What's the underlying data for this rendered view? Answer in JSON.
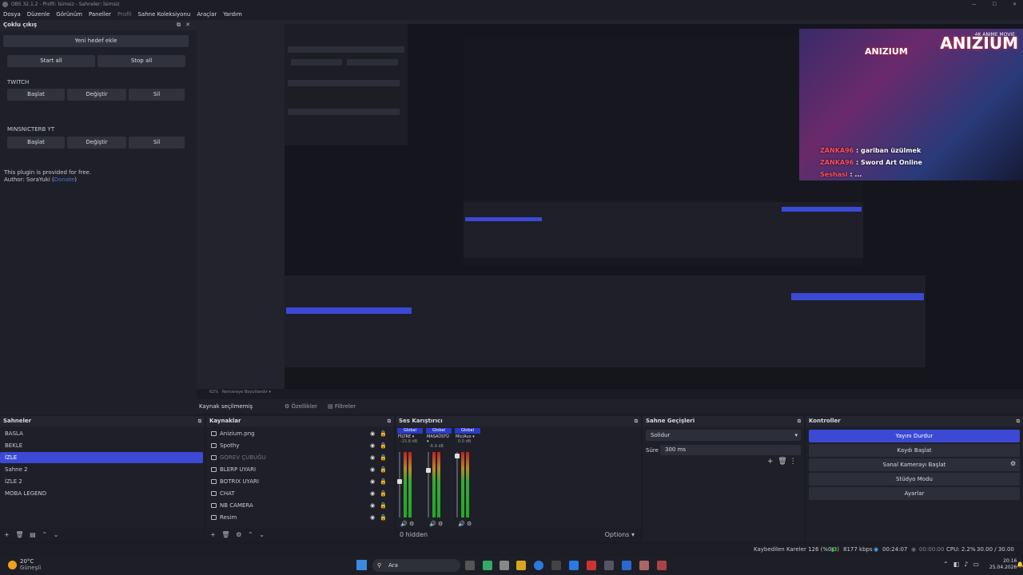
{
  "window": {
    "title": "OBS 32.1.2 - Profil: İsimsiz - Sahneler: İsimsiz"
  },
  "menu": [
    "Dosya",
    "Düzenle",
    "Görünüm",
    "Paneller",
    "Profil",
    "Sahne Koleksiyonu",
    "Araçlar",
    "Yardım"
  ],
  "multi_output": {
    "title": "Çoklu çıkış",
    "add_label": "Yeni hedef ekle",
    "start_all": "Start all",
    "stop_all": "Stop all",
    "targets": [
      {
        "name": "TWITCH",
        "start": "Başlat",
        "edit": "Değiştir",
        "delete": "Sil"
      },
      {
        "name": "MINSNICTERB YT",
        "start": "Başlat",
        "edit": "Değiştir",
        "delete": "Sil"
      }
    ],
    "note": "This plugin is provided for free.",
    "author_prefix": "Author: SoraYuki (",
    "author_link": "Donate",
    "author_suffix": ")"
  },
  "stream_overlay": {
    "brand": "ANIZIUM",
    "tagline": "4K ANIME MOVIE",
    "chat": [
      {
        "user": "ZANKA96",
        "msg": "gariban üzülmek"
      },
      {
        "user": "ZANKA96",
        "msg": "Sword Art Online"
      },
      {
        "user": "Seshasi",
        "msg": "..."
      }
    ]
  },
  "preview_status": {
    "zoom": "62%",
    "mode": "Renceraye Boyutlandır"
  },
  "context_bar": {
    "no_source": "Kaynak seçilmemiş",
    "properties": "Özellikler",
    "filters": "Filtreler"
  },
  "scenes": {
    "title": "Sahneler",
    "items": [
      "BASLA",
      "BEKLE",
      "İZLE",
      "Sahne 2",
      "İZLE 2",
      "MOBA LEGEND"
    ],
    "selected": 2
  },
  "sources": {
    "title": "Kaynaklar",
    "items": [
      "Anizium.png",
      "Spothy",
      "GOREV ÇUBUĞU",
      "BLERP UYARI",
      "BOTRIX UYARI",
      "CHAT",
      "NB CAMERA",
      "Resim"
    ]
  },
  "mixer": {
    "title": "Ses Karıştırıcı",
    "hidden": "0 hidden",
    "options": "Options",
    "channels": [
      {
        "global": "Global",
        "name": "FİLTRE",
        "db": "-15.8 dB"
      },
      {
        "global": "Global",
        "name": "MASAÜSTÜ",
        "db": "-6.9 dB"
      },
      {
        "global": "Global",
        "name": "Mic/Aux",
        "db": "0.0 dB"
      }
    ]
  },
  "transitions": {
    "title": "Sahne Geçişleri",
    "type": "Solidur",
    "duration_label": "Süre",
    "duration": "300 ms"
  },
  "controls": {
    "title": "Kontroller",
    "stop_stream": "Yayını Durdur",
    "start_record": "Kaydı Başlat",
    "virtual_cam": "Sanal Kamerayı Başlat",
    "studio": "Stüdyo Modu",
    "settings": "Ayarlar"
  },
  "status": {
    "dropped": "Kaybedilen Kareler 126 (%0.3)",
    "bitrate": "8177 kbps",
    "live": "00:24:07",
    "rec": "00:00:00",
    "cpu": "CPU: 2.2%",
    "fps": "30.00 / 30.00 FPS"
  },
  "taskbar": {
    "weather_temp": "20°C",
    "weather_text": "Güneşli",
    "search": "Ara",
    "time": "20:16",
    "date": "25.04.2026"
  },
  "colors": {
    "accent": "#3b49d4",
    "panel": "#1e1f28"
  }
}
